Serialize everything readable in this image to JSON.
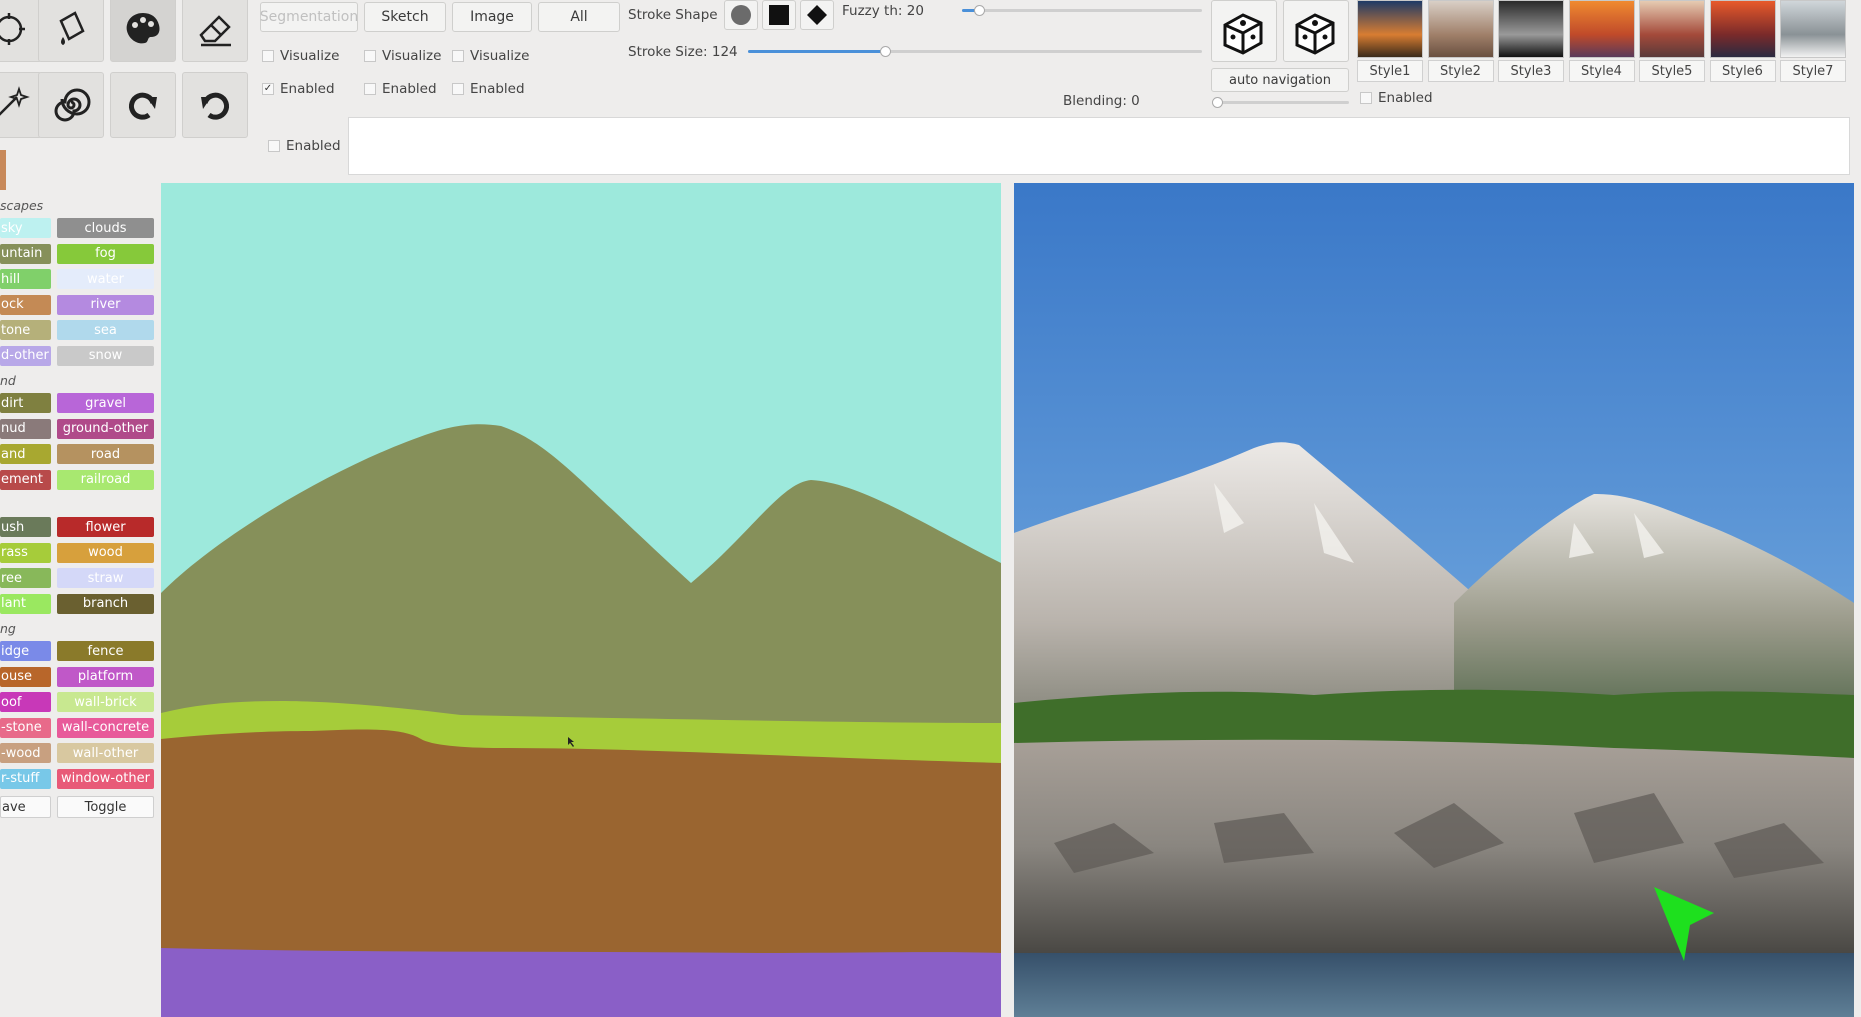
{
  "colors": {
    "sky": "#9de9dc",
    "mountain": "#86905a",
    "grass": "#a6cc3a",
    "rock": "#9a6530",
    "sea": "#8a5fc7"
  },
  "tools": {
    "row1": [
      "stamp-icon",
      "paint-bucket-icon",
      "palette-icon",
      "eraser-icon"
    ],
    "row2": [
      "magic-wand-icon",
      "spiral-icon",
      "redo-icon",
      "undo-icon"
    ]
  },
  "mode_buttons": {
    "segmentation": "Segmentation",
    "sketch": "Sketch",
    "image": "Image",
    "all": "All"
  },
  "checkboxes": {
    "visualize_1": "Visualize",
    "visualize_2": "Visualize",
    "visualize_3": "Visualize",
    "enabled_1": "Enabled",
    "enabled_2": "Enabled",
    "enabled_3": "Enabled",
    "enabled_4": "Enabled",
    "enabled_styles": "Enabled",
    "enabled_1_checked": true
  },
  "stroke": {
    "shape_label": "Stroke Shape",
    "shapes": [
      "circle-icon",
      "square-icon",
      "diamond-icon"
    ],
    "size_label": "Stroke Size: 124",
    "size_value": 124,
    "size_fraction": 0.31
  },
  "fuzzy": {
    "label": "Fuzzy th: 20",
    "value": 20,
    "fraction": 0.05
  },
  "blending": {
    "label": "Blending: 0",
    "value": 0
  },
  "navigation": {
    "dice_1": "dice-icon",
    "dice_2": "dice-icon",
    "auto_nav_label": "auto navigation"
  },
  "styles": [
    {
      "label": "Style1",
      "colors": [
        "#1e3a66",
        "#d87d32",
        "#3a2a1a"
      ]
    },
    {
      "label": "Style2",
      "colors": [
        "#d9cfc6",
        "#a0806a",
        "#6a5040"
      ]
    },
    {
      "label": "Style3",
      "colors": [
        "#2a2a2a",
        "#9a9a9a",
        "#111111"
      ]
    },
    {
      "label": "Style4",
      "colors": [
        "#f08a30",
        "#c04a2a",
        "#5a3a5a"
      ]
    },
    {
      "label": "Style5",
      "colors": [
        "#e6cbb2",
        "#a44a3a",
        "#5a3a3a"
      ]
    },
    {
      "label": "Style6",
      "colors": [
        "#e85a2a",
        "#7a2a2a",
        "#2a2a40"
      ]
    },
    {
      "label": "Style7",
      "colors": [
        "#d0d6da",
        "#8a9296",
        "#f2f2f2"
      ]
    }
  ],
  "palette": {
    "categories": [
      "scapes",
      "nd",
      "ng"
    ],
    "rows": [
      {
        "left": "sky",
        "right": "clouds",
        "lc": "#bdf1f0",
        "rc": "#8f8f8f"
      },
      {
        "left": "untain",
        "right": "fog",
        "lc": "#86905a",
        "rc": "#86c93a"
      },
      {
        "left": "hill",
        "right": "water",
        "lc": "#80d06a",
        "rc": "#e4ecfb"
      },
      {
        "left": "ock",
        "right": "river",
        "lc": "#c48a55",
        "rc": "#b48ae0"
      },
      {
        "left": "tone",
        "right": "sea",
        "lc": "#b5b07a",
        "rc": "#b0d9ec"
      },
      {
        "left": "d-other",
        "right": "snow",
        "lc": "#b8a8e8",
        "rc": "#c9c9c9"
      },
      {
        "left": "dirt",
        "right": "gravel",
        "lc": "#7f8040",
        "rc": "#b866d8"
      },
      {
        "left": "nud",
        "right": "ground-other",
        "lc": "#8a7a7a",
        "rc": "#b04a8a"
      },
      {
        "left": "and",
        "right": "road",
        "lc": "#a8a830",
        "rc": "#b59260"
      },
      {
        "left": "ement",
        "right": "railroad",
        "lc": "#b84a4a",
        "rc": "#a8e870"
      },
      {
        "left": "ush",
        "right": "flower",
        "lc": "#6a7a5a",
        "rc": "#b82a2a"
      },
      {
        "left": "rass",
        "right": "wood",
        "lc": "#a6cc3a",
        "rc": "#d7a03c"
      },
      {
        "left": "ree",
        "right": "straw",
        "lc": "#88b85a",
        "rc": "#d4d8f8"
      },
      {
        "left": "lant",
        "right": "branch",
        "lc": "#9ae860",
        "rc": "#6a6030"
      },
      {
        "left": "idge",
        "right": "fence",
        "lc": "#7a8ae8",
        "rc": "#8a7a2a"
      },
      {
        "left": "ouse",
        "right": "platform",
        "lc": "#b8662a",
        "rc": "#c058c8"
      },
      {
        "left": "oof",
        "right": "wall-brick",
        "lc": "#c838b8",
        "rc": "#c8e890"
      },
      {
        "left": "-stone",
        "right": "wall-concrete",
        "lc": "#e86a8a",
        "rc": "#e85a9a"
      },
      {
        "left": "-wood",
        "right": "wall-other",
        "lc": "#c8a080",
        "rc": "#d8c8a0"
      },
      {
        "left": "r-stuff",
        "right": "window-other",
        "lc": "#78c8e8",
        "rc": "#e85a78"
      }
    ],
    "save_label": "ave",
    "toggle_label": "Toggle"
  }
}
